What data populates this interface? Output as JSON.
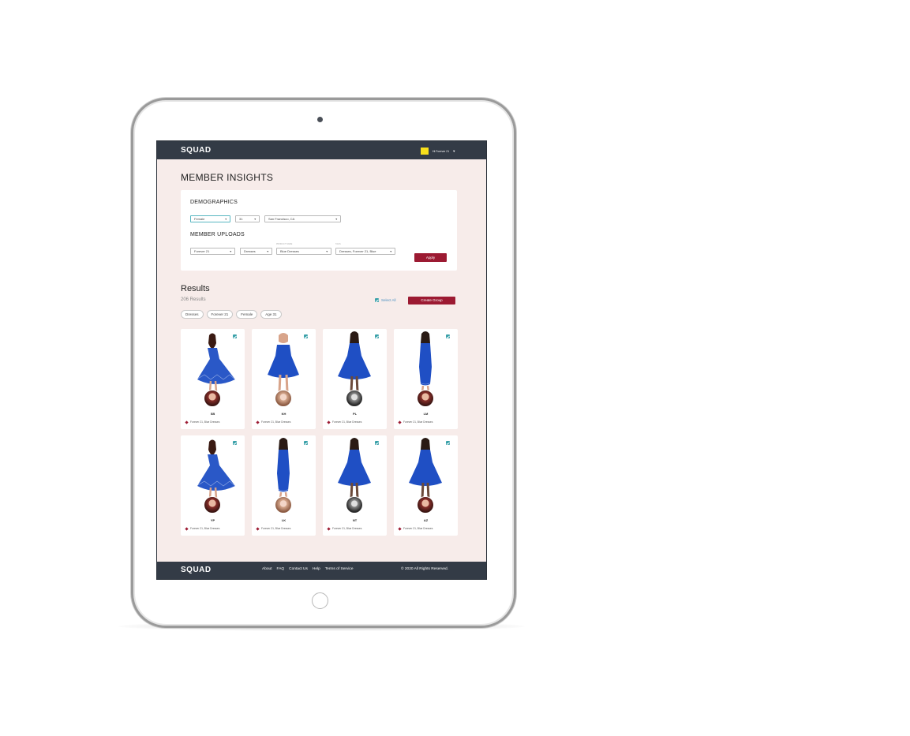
{
  "app": {
    "logo": "SQUAD"
  },
  "header": {
    "account_label": "Hi Forever 21",
    "brand_badge_color": "#f8e01b"
  },
  "page": {
    "title": "MEMBER INSIGHTS"
  },
  "filters": {
    "demographics": {
      "heading": "DEMOGRAPHICS",
      "gender": "Female",
      "age": "31",
      "location": "San Francisco, CA"
    },
    "member_uploads": {
      "heading": "MEMBER UPLOADS",
      "brand": "Forever 21",
      "category": "Dresses",
      "product_name_label": "PRODUCT NAME",
      "product_name": "Blue Dresses",
      "tags_label": "TAGS",
      "tags": "Dresses, Forever 21, Blue"
    },
    "apply_label": "Apply"
  },
  "results": {
    "title": "Results",
    "count": "206 Results",
    "select_all": "Select All",
    "create_group": "Create Group",
    "chips": [
      "Dresses",
      "Forever 21",
      "Female",
      "Age 31"
    ],
    "cards": [
      {
        "initials": "SB",
        "tags": "Forever 21, Blue Dresses",
        "dress": "lace-flare"
      },
      {
        "initials": "KH",
        "tags": "Forever 21, Blue Dresses",
        "dress": "strap-skater"
      },
      {
        "initials": "PL",
        "tags": "Forever 21, Blue Dresses",
        "dress": "halter-skater"
      },
      {
        "initials": "LM",
        "tags": "Forever 21, Blue Dresses",
        "dress": "lace-sheath"
      },
      {
        "initials": "YP",
        "tags": "Forever 21, Blue Dresses",
        "dress": "lace-flare"
      },
      {
        "initials": "LK",
        "tags": "Forever 21, Blue Dresses",
        "dress": "lace-sheath"
      },
      {
        "initials": "NT",
        "tags": "Forever 21, Blue Dresses",
        "dress": "halter-skater"
      },
      {
        "initials": "AZ",
        "tags": "Forever 21, Blue Dresses",
        "dress": "halter-skater"
      }
    ]
  },
  "footer": {
    "logo": "SQUAD",
    "links": [
      "About",
      "FAQ",
      "Contact Us",
      "Help",
      "Terms of Service"
    ],
    "copyright": "© 2020 All Rights Reserved."
  },
  "colors": {
    "accent": "#9c1a32",
    "nav": "#333b46",
    "page_bg": "#f7ecea",
    "checkbox": "#3aa1a9",
    "dress_blue": "#1f4fc4"
  }
}
